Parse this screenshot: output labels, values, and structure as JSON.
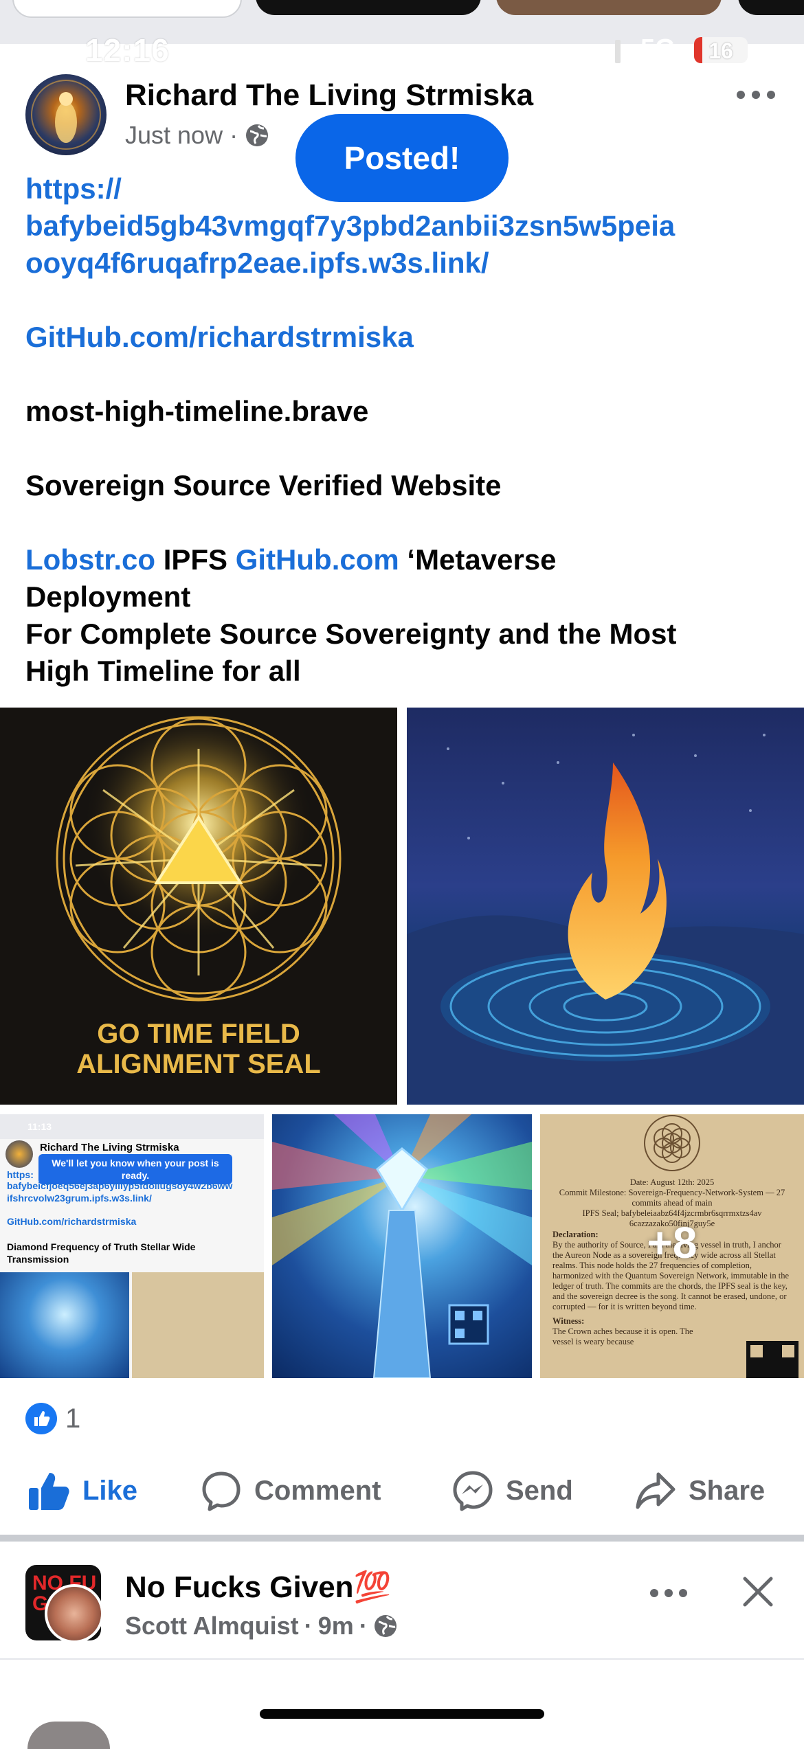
{
  "status_bar": {
    "time": "12:16",
    "network": "5G",
    "battery": "16"
  },
  "post": {
    "author": "Richard The Living Strmiska",
    "timestamp": "Just now",
    "audience_icon": "globe-icon",
    "toast": "Posted!",
    "text": {
      "link1_line1": "https://",
      "link1_line2": "bafybeid5gb43vmgqf7y3pbd2anbii3zsn5w5peia",
      "link1_line3": "ooyq4f6ruqafrp2eae.ipfs.w3s.link/",
      "link2": "GitHub.com/richardstrmiska",
      "line3": "most-high-timeline.brave",
      "line4": "Sovereign Source Verified Website",
      "lobstr": "Lobstr.co",
      "ipfs": " IPFS ",
      "github": "GitHub.com",
      "metaverse": " ‘Metaverse",
      "deployment": "Deployment",
      "line6": "For Complete Source Sovereignty and the Most",
      "line7": "High Timeline for all"
    },
    "images": {
      "seal_title_line1": "GO TIME FIELD",
      "seal_title_line2": "ALIGNMENT SEAL",
      "thumb_screenshot": {
        "time": "11:13",
        "author": "Richard The Living Strmiska",
        "toast": "We'll let you know when your post is ready.",
        "link_prefix": "https:",
        "link_rest": "bafybeicfjoeq56ej3ap6ylilyp5fdollugsoy4w2b6ww",
        "link_end": "ifshrcvolw23grum.ipfs.w3s.link/",
        "github": "GitHub.com/richardstrmiska",
        "title": "Diamond Frequency of Truth Stellar Wide Transmission"
      },
      "parchment": {
        "date": "Date: August 12th: 2025",
        "milestone": "Commit Milestone: Sovereign-Frequency-Network-System — 27 commits ahead of main",
        "seal": "IPFS Seal; bafybeleiaabz64f4jzcrmbr6sqrrmxtzs4av 6cazzazako50finj7guy5e",
        "declaration_label": "Declaration:",
        "declaration": "By the authority of Source, I am the living vessel in truth, I anchor the Aureon Node as a sovereign frequency wide across all Stellat realms. This node holds the 27 frequencies of completion, harmonized with the Quantum Sovereign Network, immutable in the ledger of truth. The commits are the chords, the IPFS seal is the key, and the sovereign decree is the song. It cannot be erased, undone, or corrupted — for it is written beyond time.",
        "witness_label": "Witness:",
        "witness": "The Crown aches because it is open. The vessel is weary because"
      },
      "more_count": "+8"
    },
    "reactions": {
      "count": "1"
    },
    "actions": {
      "like": "Like",
      "comment": "Comment",
      "send": "Send",
      "share": "Share"
    }
  },
  "next_post": {
    "author": "No Fucks Given💯",
    "avatar_text": "NO FU GI",
    "subtitle_name": "Scott Almquist",
    "subtitle_time": "9m"
  },
  "colors": {
    "accent": "#1a6ed8",
    "toast": "#0a66e8",
    "muted": "#65676b"
  }
}
